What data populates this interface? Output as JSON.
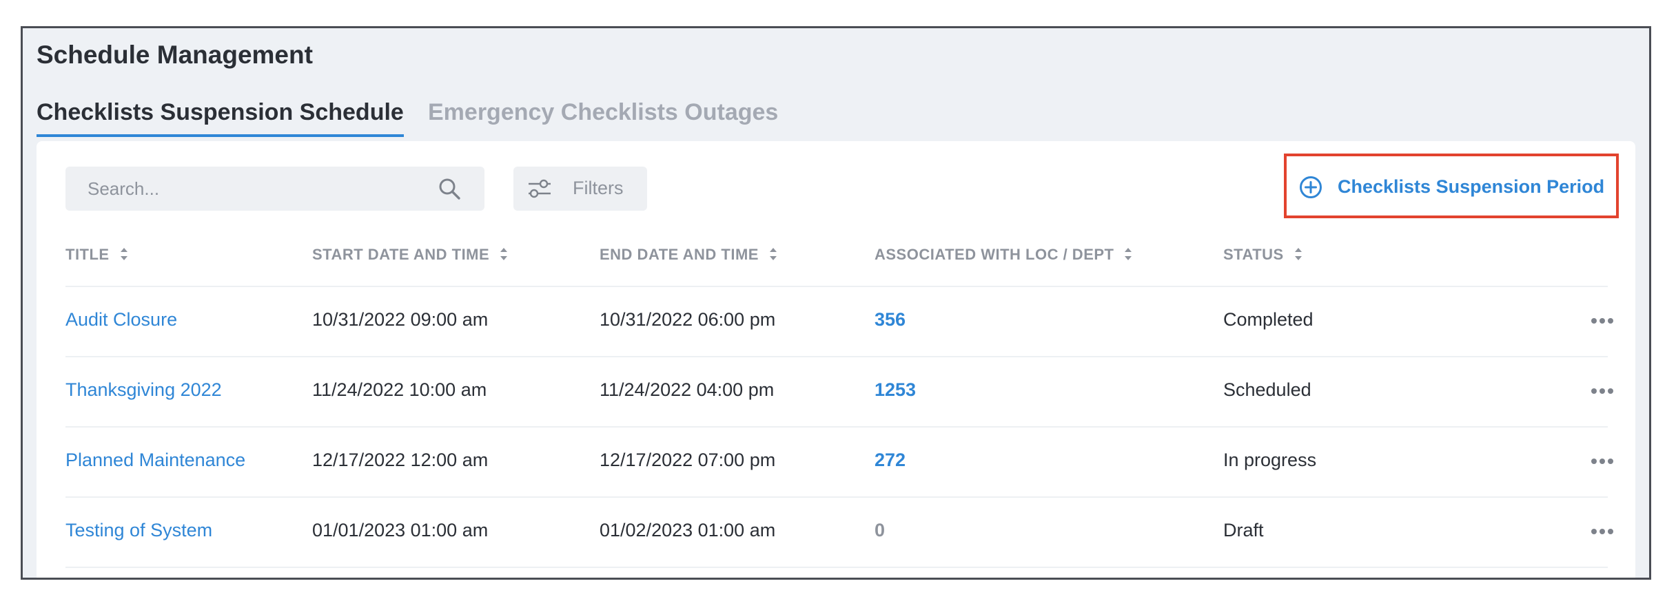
{
  "header": {
    "title": "Schedule Management"
  },
  "tabs": [
    {
      "label": "Checklists Suspension Schedule",
      "active": true
    },
    {
      "label": "Emergency Checklists Outages",
      "active": false
    }
  ],
  "toolbar": {
    "search_placeholder": "Search...",
    "search_icon": "search-icon",
    "filters_label": "Filters",
    "filters_icon": "sliders-icon",
    "add_label": "Checklists Suspension Period",
    "add_icon": "plus-circle-icon"
  },
  "colors": {
    "accent": "#2f86d6",
    "highlight_border": "#e2432e",
    "muted": "#8e939c",
    "text": "#2b2f36"
  },
  "table": {
    "columns": [
      "TITLE",
      "START DATE AND TIME",
      "END DATE AND TIME",
      "ASSOCIATED WITH LOC / DEPT",
      "STATUS"
    ],
    "rows": [
      {
        "title": "Audit Closure",
        "start": "10/31/2022  09:00 am",
        "end": "10/31/2022  06:00 pm",
        "count": "356",
        "status": "Completed"
      },
      {
        "title": "Thanksgiving 2022",
        "start": "11/24/2022  10:00 am",
        "end": "11/24/2022  04:00 pm",
        "count": "1253",
        "status": "Scheduled"
      },
      {
        "title": "Planned Maintenance",
        "start": "12/17/2022  12:00 am",
        "end": "12/17/2022  07:00 pm",
        "count": "272",
        "status": "In progress"
      },
      {
        "title": "Testing of System",
        "start": "01/01/2023  01:00 am",
        "end": "01/02/2023  01:00 am",
        "count": "0",
        "status": "Draft"
      }
    ]
  }
}
